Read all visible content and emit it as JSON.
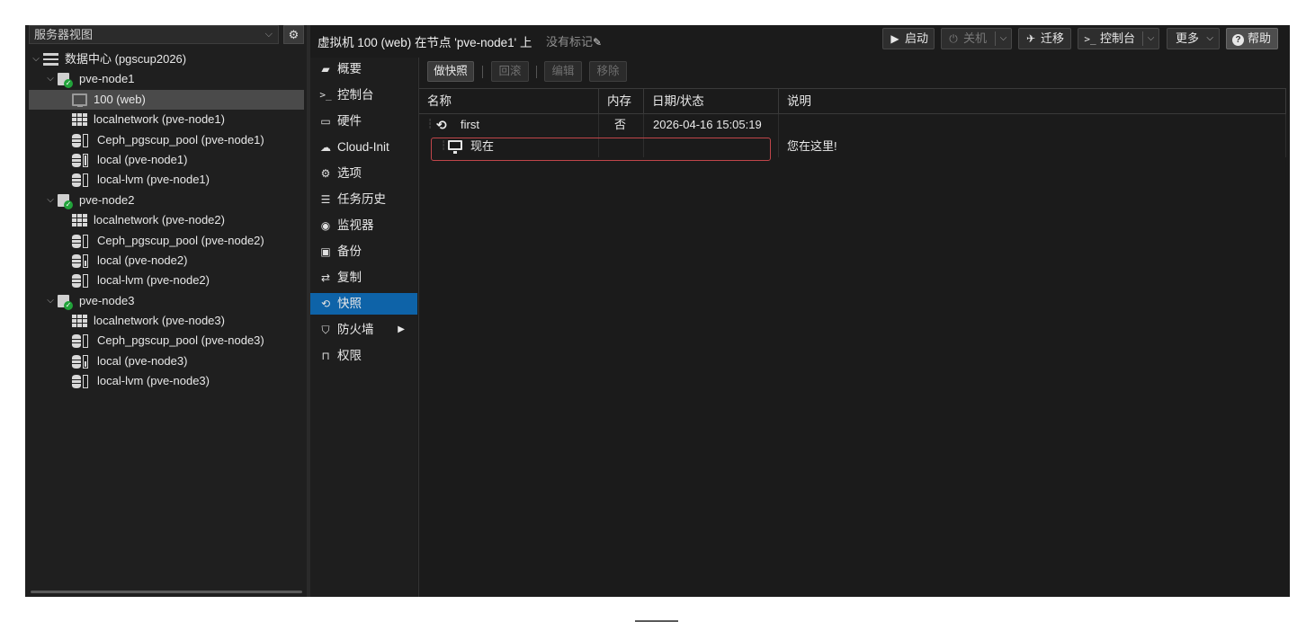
{
  "left": {
    "view_select": "服务器视图",
    "tree": [
      {
        "label": "数据中心 (pgscup2026)",
        "icon": "datacenter-icon",
        "level": 0
      },
      {
        "label": "pve-node1",
        "icon": "node-online-icon",
        "level": 1
      },
      {
        "label": "100 (web)",
        "icon": "vm-icon",
        "level": 2,
        "selected": true
      },
      {
        "label": "localnetwork (pve-node1)",
        "icon": "network-icon",
        "level": 2
      },
      {
        "label": "Ceph_pgscup_pool (pve-node1)",
        "icon": "storage-icon",
        "level": 2
      },
      {
        "label": "local (pve-node1)",
        "icon": "storage-icon",
        "level": 2
      },
      {
        "label": "local-lvm (pve-node1)",
        "icon": "storage-icon",
        "level": 2
      },
      {
        "label": "pve-node2",
        "icon": "node-online-icon",
        "level": 1
      },
      {
        "label": "localnetwork (pve-node2)",
        "icon": "network-icon",
        "level": 2
      },
      {
        "label": "Ceph_pgscup_pool (pve-node2)",
        "icon": "storage-icon",
        "level": 2
      },
      {
        "label": "local (pve-node2)",
        "icon": "storage-icon",
        "level": 2
      },
      {
        "label": "local-lvm (pve-node2)",
        "icon": "storage-icon",
        "level": 2
      },
      {
        "label": "pve-node3",
        "icon": "node-online-icon",
        "level": 1
      },
      {
        "label": "localnetwork (pve-node3)",
        "icon": "network-icon",
        "level": 2
      },
      {
        "label": "Ceph_pgscup_pool (pve-node3)",
        "icon": "storage-icon",
        "level": 2
      },
      {
        "label": "local (pve-node3)",
        "icon": "storage-icon",
        "level": 2
      },
      {
        "label": "local-lvm (pve-node3)",
        "icon": "storage-icon",
        "level": 2
      }
    ]
  },
  "header": {
    "title": "虚拟机 100 (web) 在节点 'pve-node1' 上",
    "tags": "没有标记",
    "buttons": {
      "start": "启动",
      "shutdown": "关机",
      "migrate": "迁移",
      "console": "控制台",
      "more": "更多",
      "help": "帮助"
    }
  },
  "menu": [
    {
      "label": "概要",
      "icon": "book-icon"
    },
    {
      "label": "控制台",
      "icon": "terminal-icon"
    },
    {
      "label": "硬件",
      "icon": "monitor-icon"
    },
    {
      "label": "Cloud-Init",
      "icon": "cloud-icon"
    },
    {
      "label": "选项",
      "icon": "gear-icon"
    },
    {
      "label": "任务历史",
      "icon": "list-icon"
    },
    {
      "label": "监视器",
      "icon": "eye-icon"
    },
    {
      "label": "备份",
      "icon": "floppy-icon"
    },
    {
      "label": "复制",
      "icon": "retweet-icon"
    },
    {
      "label": "快照",
      "icon": "history-icon",
      "active": true
    },
    {
      "label": "防火墙",
      "icon": "shield-icon",
      "has_submenu": true
    },
    {
      "label": "权限",
      "icon": "unlock-icon"
    }
  ],
  "snapshot": {
    "toolbar": {
      "take": "做快照",
      "rollback": "回滚",
      "edit": "编辑",
      "remove": "移除"
    },
    "columns": [
      "名称",
      "内存",
      "日期/状态",
      "说明"
    ],
    "rows": [
      {
        "name": "first",
        "ram": "否",
        "date": "2026-04-16 15:05:19",
        "description": "",
        "icon": "history-icon"
      },
      {
        "name": "现在",
        "ram": "",
        "date": "",
        "description": "您在这里!",
        "icon": "monitor-icon"
      }
    ]
  },
  "colors": {
    "accent": "#0e63a8",
    "highlight_border": "#c0454a",
    "node_status_ok": "#21a33a"
  }
}
